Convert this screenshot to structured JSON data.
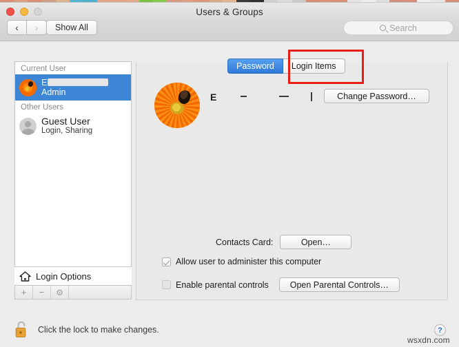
{
  "window": {
    "title": "Users & Groups",
    "traffic_lights": [
      "close",
      "minimize",
      "zoom"
    ]
  },
  "toolbar": {
    "back_label": "‹",
    "forward_label": "›",
    "show_all_label": "Show All",
    "search": {
      "placeholder": "Search",
      "value": "",
      "icon": "search-icon"
    }
  },
  "sidebar": {
    "groups": [
      {
        "header": "Current User",
        "users": [
          {
            "name_visible_fragment": "E",
            "name_redacted": true,
            "role": "Admin",
            "selected": true,
            "avatar": "orange-flower-photo"
          }
        ]
      },
      {
        "header": "Other Users",
        "users": [
          {
            "name": "Guest User",
            "role": "Login, Sharing",
            "selected": false,
            "avatar": "generic-person-silhouette"
          }
        ]
      }
    ],
    "login_options_label": "Login Options",
    "login_options_icon": "house-icon",
    "footer_buttons": [
      {
        "name": "add-user-button",
        "glyph": "+"
      },
      {
        "name": "remove-user-button",
        "glyph": "−"
      },
      {
        "name": "settings-gear-button",
        "glyph": "⚙"
      }
    ]
  },
  "tabs": [
    {
      "label": "Password",
      "selected": true
    },
    {
      "label": "Login Items",
      "selected": false,
      "annotated": true
    }
  ],
  "annotation": {
    "color": "#e81d16",
    "target": "Login Items",
    "shape": "rectangle"
  },
  "main": {
    "account_avatar": "orange-flower-photo",
    "full_name_redacted": true,
    "full_name_visible_fragment": "E",
    "change_password_label": "Change Password…",
    "contacts_card_label": "Contacts Card:",
    "contacts_open_label": "Open…",
    "admin_checkbox": {
      "label": "Allow user to administer this computer",
      "checked": true
    },
    "parental_checkbox": {
      "label": "Enable parental controls",
      "checked": false
    },
    "open_parental_label": "Open Parental Controls…"
  },
  "footer": {
    "lock_text": "Click the lock to make changes.",
    "lock_icon": "padlock-open-icon",
    "lock_color": "#e8a23a",
    "help_label": "?",
    "watermark": "wsxdn.com"
  },
  "desktop_strip_colors": [
    "#d98d74",
    "#dba07f",
    "#d98d74",
    "#cf9f86",
    "#d9b48f",
    "#55b3cf",
    "#4fb0cc",
    "#e2a68c",
    "#e0a288",
    "#e3a98f",
    "#7cc241",
    "#86c94c",
    "#d89a84",
    "#dc9d84",
    "#d9957e",
    "#d7a882",
    "#e0b78f",
    "#3b3b3b",
    "#2f2f2f",
    "#cfcfcf",
    "#dcdcdc",
    "#c9c9c9",
    "#d68d76",
    "#d9927a",
    "#d78f77",
    "#e3e3e3",
    "#ededed",
    "#dedede",
    "#cf8f7b",
    "#d4907c",
    "#f0f0f0",
    "#e6e6e6",
    "#d28e79"
  ]
}
